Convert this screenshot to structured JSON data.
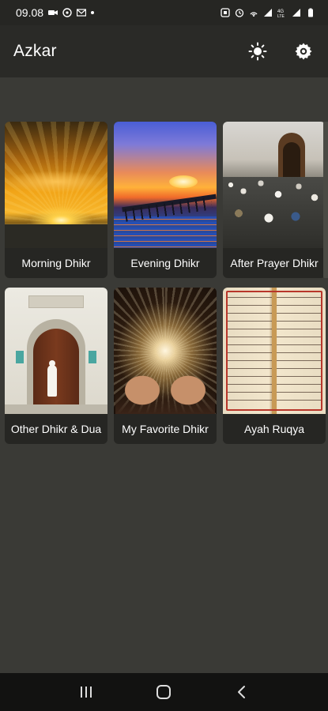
{
  "status_bar": {
    "time": "09.08",
    "icons": [
      "video-icon",
      "whatsapp-icon",
      "gmail-icon",
      "notification-dot",
      "alarm-icon",
      "alarm-clock-icon",
      "hotspot-icon",
      "signal-icon",
      "4g-icon",
      "signal-icon",
      "battery-icon"
    ]
  },
  "app_bar": {
    "title": "Azkar",
    "actions": [
      "brightness-icon",
      "settings-icon"
    ]
  },
  "grid": {
    "items": [
      {
        "label": "Morning Dhikr",
        "image": "sunrise-image"
      },
      {
        "label": "Evening Dhikr",
        "image": "sunset-pier-image"
      },
      {
        "label": "After Prayer Dhikr",
        "image": "mosque-crowd-image"
      },
      {
        "label": "Other Dhikr & Dua",
        "image": "mosque-door-image"
      },
      {
        "label": "My Favorite Dhikr",
        "image": "praying-hands-image"
      },
      {
        "label": "Ayah Ruqya",
        "image": "quran-book-image"
      }
    ]
  },
  "nav_bar": {
    "buttons": [
      "recent-apps-icon",
      "home-icon",
      "back-icon"
    ]
  },
  "colors": {
    "background": "#3a3a36",
    "app_bar": "#2a2a27",
    "card": "#262623",
    "text": "#ffffff"
  }
}
